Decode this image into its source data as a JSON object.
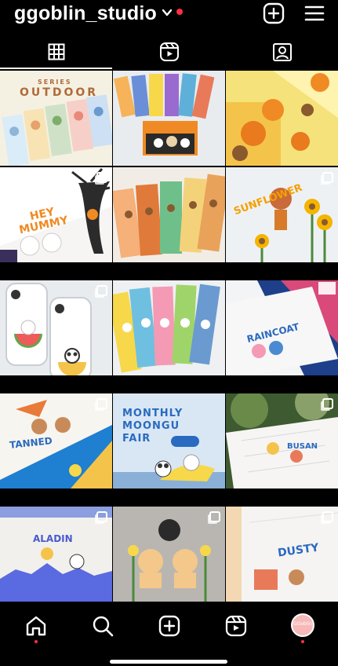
{
  "header": {
    "username": "ggoblin_studio",
    "chevron_icon": "chevron-down-icon",
    "create_icon": "plus-square-icon",
    "menu_icon": "hamburger-menu-icon",
    "notification_color": "#ff3040"
  },
  "tabs": [
    {
      "name": "grid",
      "icon": "grid-icon",
      "active": true
    },
    {
      "name": "reels",
      "icon": "reels-icon",
      "active": false
    },
    {
      "name": "tagged",
      "icon": "tagged-person-icon",
      "active": false
    }
  ],
  "posts": [
    {
      "id": "outdoor",
      "text_1": "SERIES",
      "text_2": "OUTDOOR",
      "multi": false
    },
    {
      "id": "halloween-box",
      "multi": false
    },
    {
      "id": "pumpkins",
      "multi": false
    },
    {
      "id": "hey-mummy",
      "text_1": "HEY",
      "text_2": "MUMMY",
      "multi": true
    },
    {
      "id": "autumn-stickers",
      "multi": false
    },
    {
      "id": "sunflower",
      "text_1": "SUNFLOWER",
      "multi": true
    },
    {
      "id": "watermelon-phones",
      "multi": true
    },
    {
      "id": "sticker-sheets",
      "multi": false
    },
    {
      "id": "raincoat",
      "text_1": "RAINCOAT",
      "multi": false
    },
    {
      "id": "tanned",
      "text_1": "TANNED",
      "multi": true
    },
    {
      "id": "monthly-moongu",
      "text_1": "MONTHLY",
      "text_2": "MOONGU",
      "text_3": "FAIR",
      "multi": false
    },
    {
      "id": "busan",
      "text_1": "BUSAN",
      "multi": true
    },
    {
      "id": "aladin",
      "text_1": "ALADIN",
      "multi": true
    },
    {
      "id": "tulip-bears",
      "multi": true
    },
    {
      "id": "dusty",
      "text_1": "DUSTY",
      "multi": true
    }
  ],
  "bottom_nav": [
    {
      "name": "home",
      "icon": "home-icon",
      "dot": true
    },
    {
      "name": "search",
      "icon": "search-icon",
      "dot": false
    },
    {
      "name": "create",
      "icon": "plus-square-icon",
      "dot": false
    },
    {
      "name": "reels",
      "icon": "reels-icon",
      "dot": false
    },
    {
      "name": "profile",
      "icon": "avatar",
      "dot": true
    }
  ],
  "avatar_text": "GGoblin"
}
